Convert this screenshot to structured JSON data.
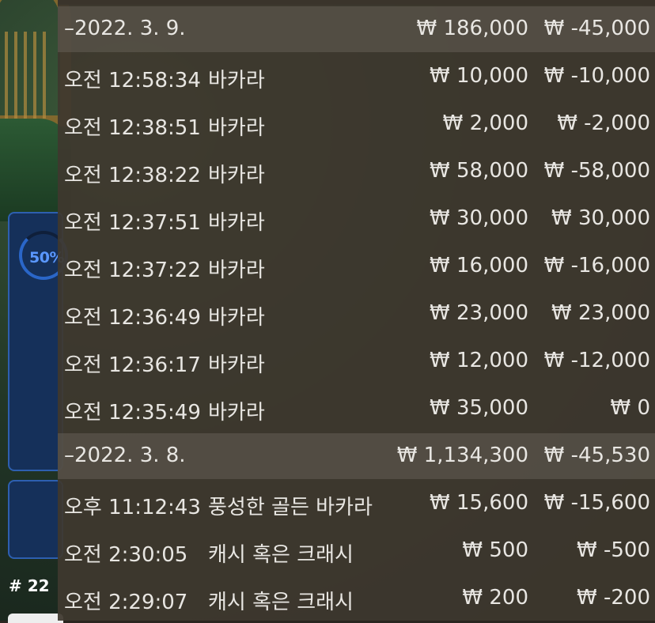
{
  "side": {
    "progress_text": "50%",
    "table_number": "# 22"
  },
  "history": {
    "groups": [
      {
        "date": "–2022. 3. 9.",
        "total_bet": "₩ 186,000",
        "total_win": "₩ -45,000",
        "rows": [
          {
            "time": "오전 12:58:34",
            "game": "바카라",
            "bet": "₩ 10,000",
            "win": "₩ -10,000"
          },
          {
            "time": "오전 12:38:51",
            "game": "바카라",
            "bet": "₩ 2,000",
            "win": "₩ -2,000"
          },
          {
            "time": "오전 12:38:22",
            "game": "바카라",
            "bet": "₩ 58,000",
            "win": "₩ -58,000"
          },
          {
            "time": "오전 12:37:51",
            "game": "바카라",
            "bet": "₩ 30,000",
            "win": "₩ 30,000"
          },
          {
            "time": "오전 12:37:22",
            "game": "바카라",
            "bet": "₩ 16,000",
            "win": "₩ -16,000"
          },
          {
            "time": "오전 12:36:49",
            "game": "바카라",
            "bet": "₩ 23,000",
            "win": "₩ 23,000"
          },
          {
            "time": "오전 12:36:17",
            "game": "바카라",
            "bet": "₩ 12,000",
            "win": "₩ -12,000"
          },
          {
            "time": "오전 12:35:49",
            "game": "바카라",
            "bet": "₩ 35,000",
            "win": "₩ 0"
          }
        ]
      },
      {
        "date": "–2022. 3. 8.",
        "total_bet": "₩ 1,134,300",
        "total_win": "₩ -45,530",
        "rows": [
          {
            "time": "오후 11:12:43",
            "game": "풍성한 골든 바카라",
            "bet": "₩ 15,600",
            "win": "₩ -15,600"
          },
          {
            "time": "오전 2:30:05",
            "game": "캐시 혹은 크래시",
            "bet": "₩ 500",
            "win": "₩ -500"
          },
          {
            "time": "오전 2:29:07",
            "game": "캐시 혹은 크래시",
            "bet": "₩ 200",
            "win": "₩ -200"
          }
        ]
      }
    ]
  }
}
